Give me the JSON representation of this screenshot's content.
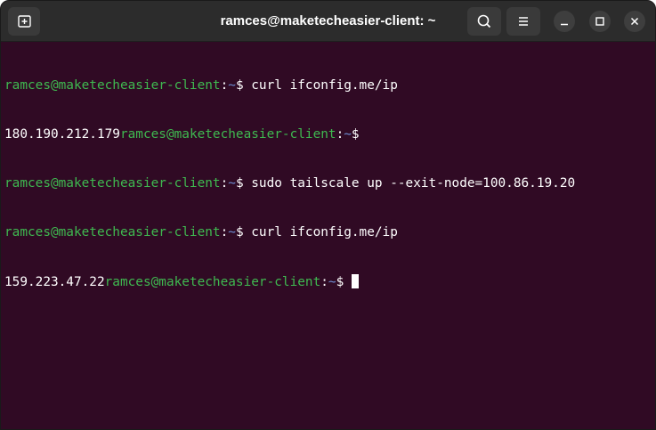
{
  "window": {
    "title": "ramces@maketecheasier-client: ~"
  },
  "titlebar": {
    "new_tab_icon": "new-tab-icon",
    "search_icon": "search-icon",
    "menu_icon": "hamburger-menu-icon",
    "minimize_icon": "minimize-icon",
    "maximize_icon": "maximize-icon",
    "close_icon": "close-icon"
  },
  "colors": {
    "background": "#300a24",
    "titlebar": "#2c2c2c",
    "prompt_user": "#3fb950",
    "prompt_path": "#6f8fd6",
    "text": "#ffffff"
  },
  "terminal": {
    "lines": [
      {
        "output": "",
        "user": "ramces@maketecheasier-client",
        "sep": ":",
        "path": "~",
        "cmd": "$ curl ifconfig.me/ip"
      },
      {
        "output": "180.190.212.179",
        "user": "ramces@maketecheasier-client",
        "sep": ":",
        "path": "~",
        "cmd": "$"
      },
      {
        "output": "",
        "user": "ramces@maketecheasier-client",
        "sep": ":",
        "path": "~",
        "cmd": "$ sudo tailscale up --exit-node=100.86.19.20"
      },
      {
        "output": "",
        "user": "ramces@maketecheasier-client",
        "sep": ":",
        "path": "~",
        "cmd": "$ curl ifconfig.me/ip"
      },
      {
        "output": "159.223.47.22",
        "user": "ramces@maketecheasier-client",
        "sep": ":",
        "path": "~",
        "cmd": "$ "
      }
    ]
  }
}
